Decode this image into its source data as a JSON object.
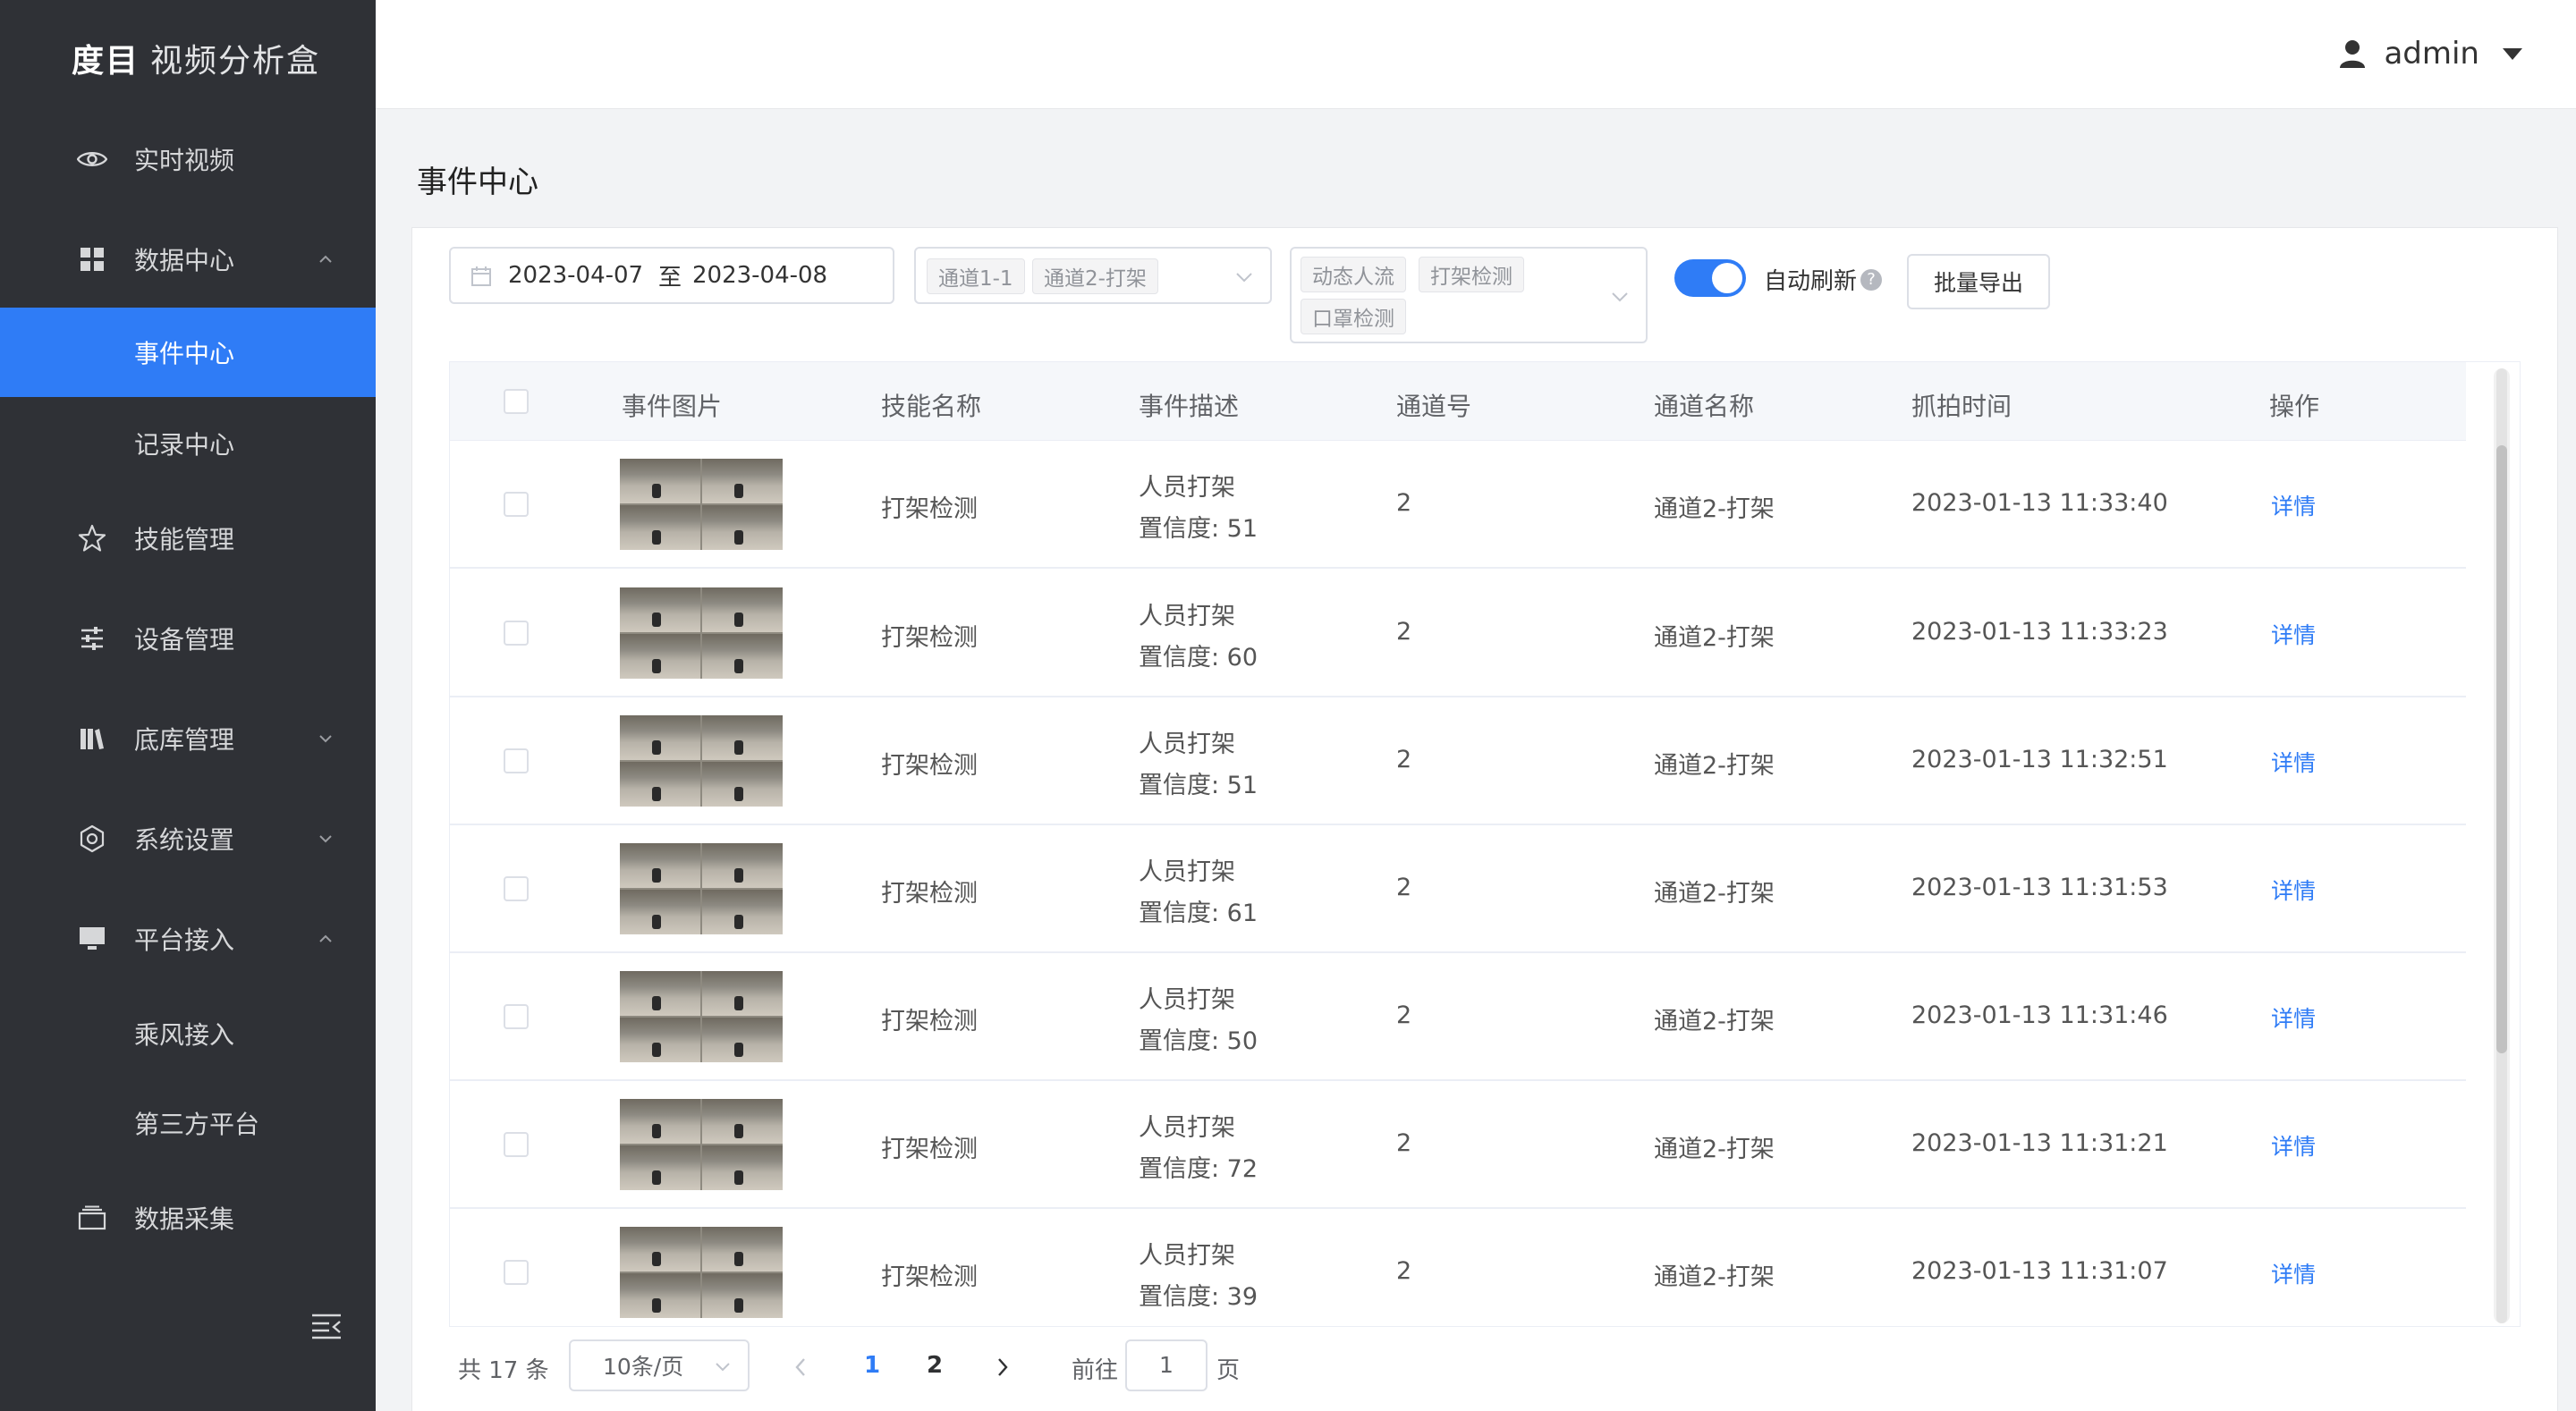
{
  "app": {
    "brand": "度目",
    "subtitle": "视频分析盒"
  },
  "header": {
    "user": "admin"
  },
  "sidebar": {
    "items": [
      {
        "label": "实时视频",
        "icon": "eye-icon"
      },
      {
        "label": "数据中心",
        "icon": "grid-icon",
        "expanded": true
      },
      {
        "label": "事件中心",
        "sub": true,
        "active": true
      },
      {
        "label": "记录中心",
        "sub": true
      },
      {
        "label": "技能管理",
        "icon": "star-icon"
      },
      {
        "label": "设备管理",
        "icon": "sliders-icon"
      },
      {
        "label": "底库管理",
        "icon": "library-icon",
        "expanded": false
      },
      {
        "label": "系统设置",
        "icon": "gear-icon",
        "expanded": false
      },
      {
        "label": "平台接入",
        "icon": "monitor-icon",
        "expanded": true
      },
      {
        "label": "乘风接入",
        "sub": true
      },
      {
        "label": "第三方平台",
        "sub": true
      },
      {
        "label": "数据采集",
        "icon": "box-icon"
      }
    ]
  },
  "page": {
    "title": "事件中心"
  },
  "filters": {
    "date_start": "2023-04-07",
    "date_sep": "至",
    "date_end": "2023-04-08",
    "channels": [
      "通道1-1",
      "通道2-打架"
    ],
    "skills": [
      "动态人流",
      "打架检测",
      "口罩检测"
    ],
    "auto_refresh_label": "自动刷新",
    "auto_refresh_on": true,
    "help_mark": "?",
    "export_label": "批量导出"
  },
  "table": {
    "columns": [
      "事件图片",
      "技能名称",
      "事件描述",
      "通道号",
      "通道名称",
      "抓拍时间",
      "操作"
    ],
    "rows": [
      {
        "skill": "打架检测",
        "desc": "人员打架",
        "conf": "置信度: 51",
        "channel_no": "2",
        "channel_name": "通道2-打架",
        "time": "2023-01-13 11:33:40",
        "action": "详情"
      },
      {
        "skill": "打架检测",
        "desc": "人员打架",
        "conf": "置信度: 60",
        "channel_no": "2",
        "channel_name": "通道2-打架",
        "time": "2023-01-13 11:33:23",
        "action": "详情"
      },
      {
        "skill": "打架检测",
        "desc": "人员打架",
        "conf": "置信度: 51",
        "channel_no": "2",
        "channel_name": "通道2-打架",
        "time": "2023-01-13 11:32:51",
        "action": "详情"
      },
      {
        "skill": "打架检测",
        "desc": "人员打架",
        "conf": "置信度: 61",
        "channel_no": "2",
        "channel_name": "通道2-打架",
        "time": "2023-01-13 11:31:53",
        "action": "详情"
      },
      {
        "skill": "打架检测",
        "desc": "人员打架",
        "conf": "置信度: 50",
        "channel_no": "2",
        "channel_name": "通道2-打架",
        "time": "2023-01-13 11:31:46",
        "action": "详情"
      },
      {
        "skill": "打架检测",
        "desc": "人员打架",
        "conf": "置信度: 72",
        "channel_no": "2",
        "channel_name": "通道2-打架",
        "time": "2023-01-13 11:31:21",
        "action": "详情"
      },
      {
        "skill": "打架检测",
        "desc": "人员打架",
        "conf": "置信度: 39",
        "channel_no": "2",
        "channel_name": "通道2-打架",
        "time": "2023-01-13 11:31:07",
        "action": "详情"
      }
    ]
  },
  "pagination": {
    "total": "共 17 条",
    "page_size": "10条/页",
    "pages": [
      "1",
      "2"
    ],
    "current": "1",
    "goto_prefix": "前往",
    "goto_value": "1",
    "goto_suffix": "页"
  },
  "colors": {
    "accent": "#2f7cf6",
    "sidebar_bg": "#2f3136"
  }
}
